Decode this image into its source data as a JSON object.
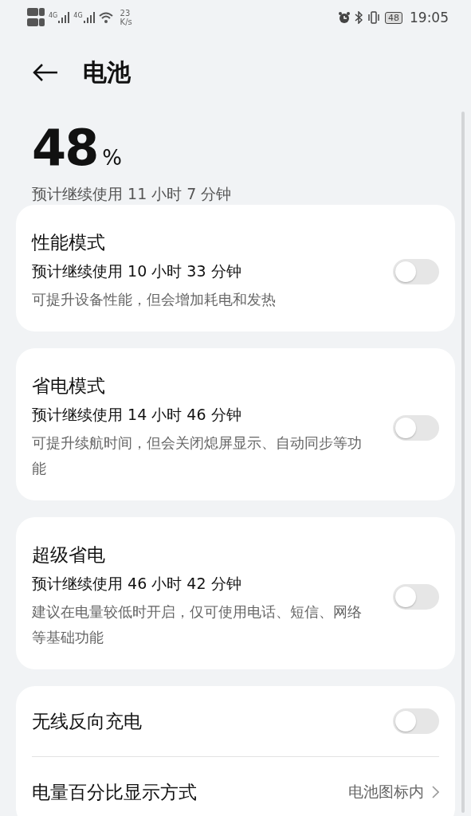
{
  "status_bar": {
    "sim_labels": [
      "4G",
      "4G"
    ],
    "speed": "23",
    "speed_unit": "K/s",
    "battery": "48",
    "time": "19:05"
  },
  "header": {
    "title": "电池"
  },
  "battery": {
    "percent": "48",
    "unit": "%",
    "estimate": "预计继续使用 11 小时 7 分钟"
  },
  "modes": [
    {
      "title": "性能模式",
      "estimate": "预计继续使用 10 小时 33 分钟",
      "description": "可提升设备性能，但会增加耗电和发热",
      "on": false
    },
    {
      "title": "省电模式",
      "estimate": "预计继续使用 14 小时 46 分钟",
      "description": "可提升续航时间，但会关闭熄屏显示、自动同步等功能",
      "on": false
    },
    {
      "title": "超级省电",
      "estimate": "预计继续使用 46 小时 42 分钟",
      "description": "建议在电量较低时开启，仅可使用电话、短信、网络等基础功能",
      "on": false
    }
  ],
  "settings": [
    {
      "kind": "toggle",
      "label": "无线反向充电",
      "on": false
    },
    {
      "kind": "link",
      "label": "电量百分比显示方式",
      "value": "电池图标内"
    }
  ]
}
